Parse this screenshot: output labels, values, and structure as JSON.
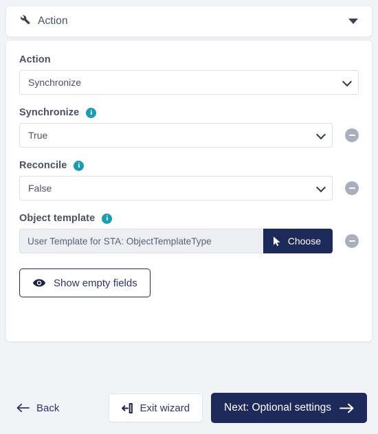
{
  "panel": {
    "title": "Action",
    "wrench_icon": "wrench-icon",
    "collapse_icon": "caret-down-icon"
  },
  "fields": [
    {
      "label": "Action",
      "has_info": false,
      "value": "Synchronize",
      "has_remove": false
    },
    {
      "label": "Synchronize",
      "has_info": true,
      "info_icon": "info-icon",
      "value": "True",
      "has_remove": true
    },
    {
      "label": "Reconcile",
      "has_info": true,
      "info_icon": "info-icon",
      "value": "False",
      "has_remove": true
    },
    {
      "label": "Object template",
      "has_info": true,
      "info_icon": "info-icon",
      "value": "User Template for STA: ObjectTemplateType",
      "choose_label": "Choose",
      "choose_icon": "cursor-arrow-icon",
      "has_remove": true
    }
  ],
  "show_empty": {
    "label": "Show empty fields",
    "icon": "eye-icon"
  },
  "footer": {
    "back_label": "Back",
    "back_icon": "arrow-left-icon",
    "exit_label": "Exit wizard",
    "exit_icon": "sign-out-icon",
    "next_label": "Next: Optional settings",
    "next_icon": "arrow-right-icon"
  },
  "colors": {
    "navy": "#1e2a5a",
    "info_teal": "#1b9cb0",
    "page_bg": "#f2f3f7",
    "remove_gray": "#a9afbd"
  },
  "info_tooltip_label": "i"
}
